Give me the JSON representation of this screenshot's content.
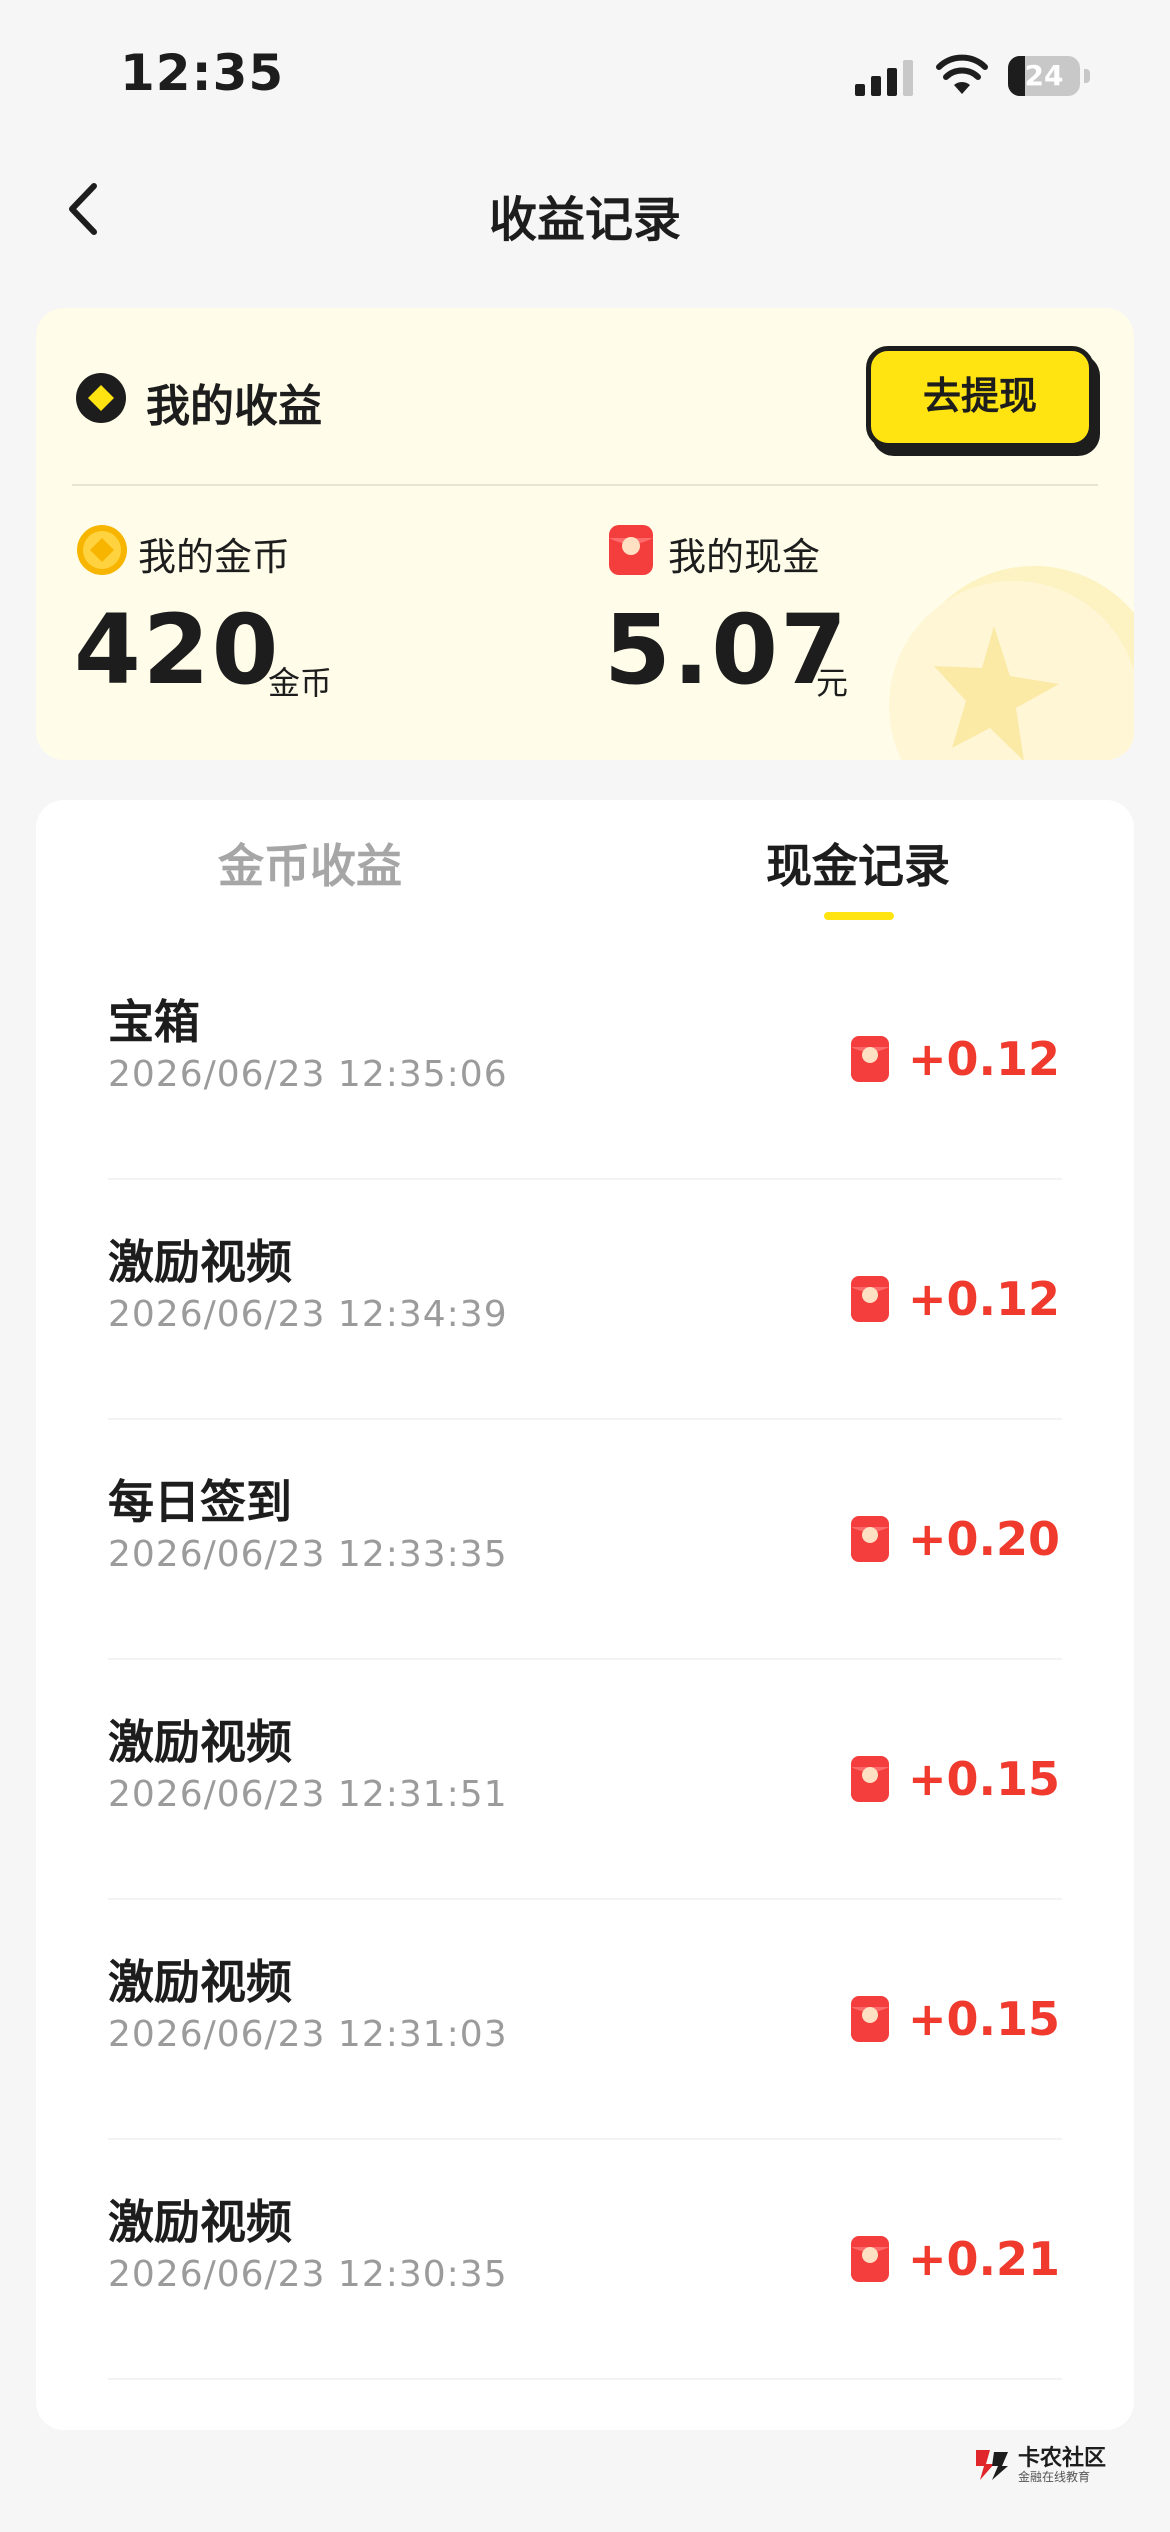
{
  "status_bar": {
    "time": "12:35",
    "battery": "24",
    "battery_level": 0.24
  },
  "nav": {
    "title": "收益记录"
  },
  "earnings_card": {
    "title": "我的收益",
    "withdraw_label": "去提现",
    "coins": {
      "label": "我的金币",
      "value": "420",
      "unit": "金币"
    },
    "cash": {
      "label": "我的现金",
      "value": "5.07",
      "unit": "元"
    }
  },
  "tabs": [
    {
      "label": "金币收益",
      "active": false
    },
    {
      "label": "现金记录",
      "active": true
    }
  ],
  "records": [
    {
      "title": "宝箱",
      "time": "2026/06/23 12:35:06",
      "amount": "+0.12"
    },
    {
      "title": "激励视频",
      "time": "2026/06/23 12:34:39",
      "amount": "+0.12"
    },
    {
      "title": "每日签到",
      "time": "2026/06/23 12:33:35",
      "amount": "+0.20"
    },
    {
      "title": "激励视频",
      "time": "2026/06/23 12:31:51",
      "amount": "+0.15"
    },
    {
      "title": "激励视频",
      "time": "2026/06/23 12:31:03",
      "amount": "+0.15"
    },
    {
      "title": "激励视频",
      "time": "2026/06/23 12:30:35",
      "amount": "+0.21"
    }
  ],
  "watermark": {
    "name": "卡农社区",
    "slogan": "金融在线教育"
  },
  "colors": {
    "accent": "#ffe412",
    "amount": "#f03a2e",
    "card_background": "#fffde9"
  },
  "icons": {
    "back": "chevron-left-icon",
    "earnings": "diamond-icon",
    "coins": "gold-coin-icon",
    "cash": "red-envelope-icon"
  }
}
